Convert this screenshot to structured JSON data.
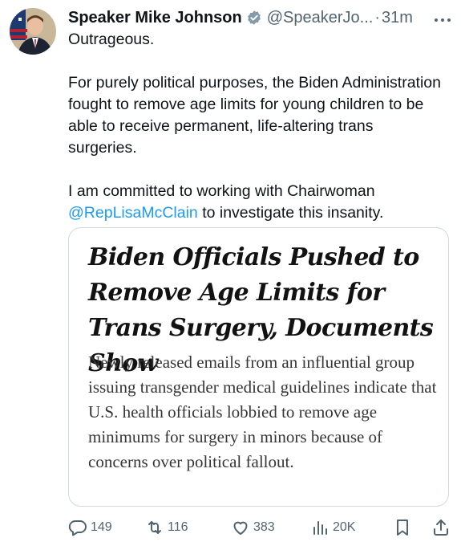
{
  "author": {
    "name": "Speaker Mike Johnson",
    "handle": "@SpeakerJo...",
    "separator": "·",
    "time": "31m",
    "verified_color": "#1d9bf0"
  },
  "tweet": {
    "line1": "Outrageous.",
    "paragraph2": "For purely political purposes, the Biden Administration fought to remove age limits for young children to be able to receive permanent, life-altering trans surgeries.",
    "paragraph3_prefix": "I am committed to working with Chairwoman",
    "mention": "@RepLisaMcClain",
    "paragraph3_suffix": " to investigate this insanity."
  },
  "card": {
    "headline": "Biden Officials Pushed to Remove Age Limits for Trans Surgery, Documents Show",
    "summary": "Newly released emails from an influential group issuing transgender medical guidelines indicate that U.S. health officials lobbied to remove age minimums for surgery in minors because of concerns over political fallout."
  },
  "actions": {
    "replies": "149",
    "reposts": "116",
    "likes": "383",
    "views": "20K"
  },
  "icons": {
    "more": "more-icon",
    "reply": "reply-icon",
    "repost": "repost-icon",
    "like": "heart-icon",
    "views": "views-icon",
    "bookmark": "bookmark-icon",
    "share": "share-icon"
  },
  "colors": {
    "text": "#0f1419",
    "secondary": "#536471",
    "link": "#1d9bf0",
    "border": "#cfd9de"
  }
}
